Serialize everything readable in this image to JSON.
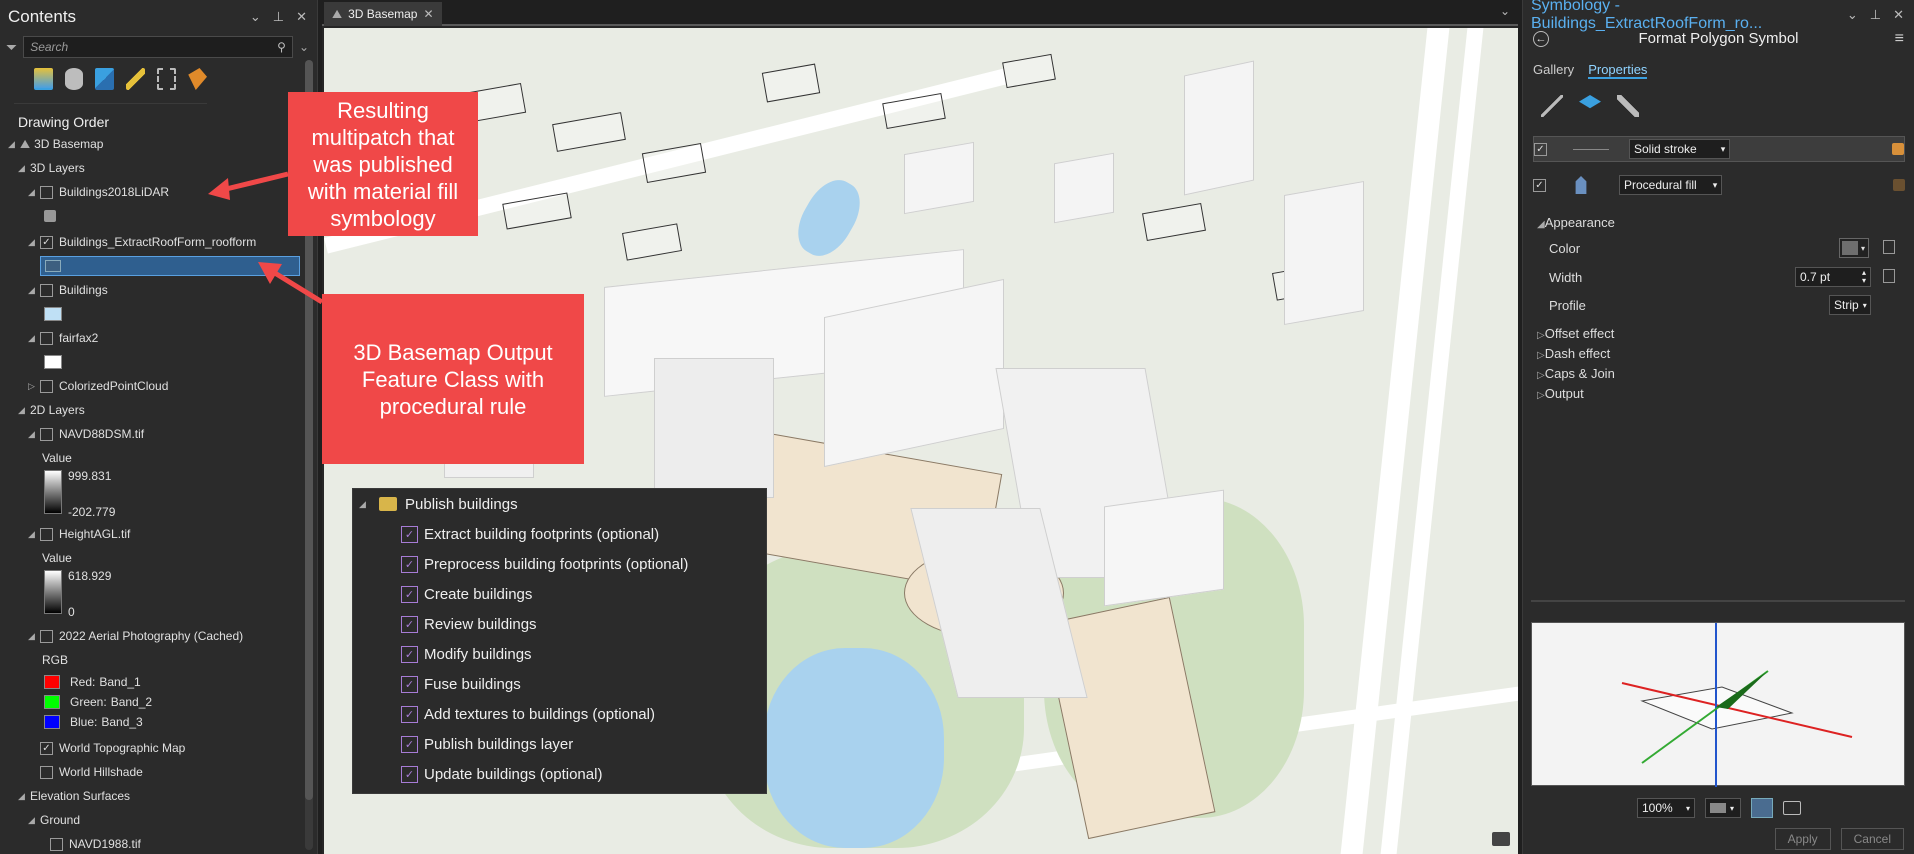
{
  "contents": {
    "title": "Contents",
    "search_placeholder": "Search",
    "section": "Drawing Order",
    "map_name": "3D Basemap",
    "groups": {
      "layers3d": "3D Layers",
      "layers2d": "2D Layers",
      "elevation": "Elevation Surfaces",
      "ground": "Ground"
    },
    "items": {
      "lidar": "Buildings2018LiDAR",
      "roofform": "Buildings_ExtractRoofForm_roofform",
      "buildings": "Buildings",
      "fairfax": "fairfax2",
      "pointcloud": "ColorizedPointCloud",
      "navd": "NAVD88DSM.tif",
      "heightagl": "HeightAGL.tif",
      "aerial": "2022 Aerial Photography (Cached)",
      "topo": "World Topographic Map",
      "hillshade": "World Hillshade",
      "navd1988": "NAVD1988.tif"
    },
    "legend": {
      "value_label": "Value",
      "navd_max": "999.831",
      "navd_min": "-202.779",
      "agl_max": "618.929",
      "agl_min": "0",
      "rgb_label": "RGB",
      "red": "Red:",
      "red_band": "Band_1",
      "green": "Green:",
      "green_band": "Band_2",
      "blue": "Blue:",
      "blue_band": "Band_3"
    }
  },
  "map": {
    "tab_label": "3D Basemap"
  },
  "callouts": {
    "top": "Resulting multipatch that was published with material fill symbology",
    "bottom": "3D Basemap Output Feature Class with procedural rule"
  },
  "workflow": {
    "title": "Publish buildings",
    "steps": [
      "Extract building footprints (optional)",
      "Preprocess building footprints (optional)",
      "Create buildings",
      "Review buildings",
      "Modify buildings",
      "Fuse buildings",
      "Add textures to buildings (optional)",
      "Publish buildings layer",
      "Update buildings (optional)"
    ]
  },
  "symbology": {
    "title": "Symbology - Buildings_ExtractRoofForm_ro...",
    "subtitle": "Format Polygon Symbol",
    "tab_gallery": "Gallery",
    "tab_properties": "Properties",
    "layer1": "Solid stroke",
    "layer2": "Procedural fill",
    "appearance": "Appearance",
    "color_label": "Color",
    "width_label": "Width",
    "width_value": "0.7 pt",
    "profile_label": "Profile",
    "profile_value": "Strip",
    "offset": "Offset effect",
    "dash": "Dash effect",
    "caps": "Caps & Join",
    "output": "Output",
    "zoom": "100%",
    "apply": "Apply",
    "cancel": "Cancel"
  },
  "colors": {
    "callout": "#f04848",
    "accent": "#3aa0e0",
    "red_band": "#ff0000",
    "green_band": "#00ff00",
    "blue_band": "#0000ff"
  }
}
